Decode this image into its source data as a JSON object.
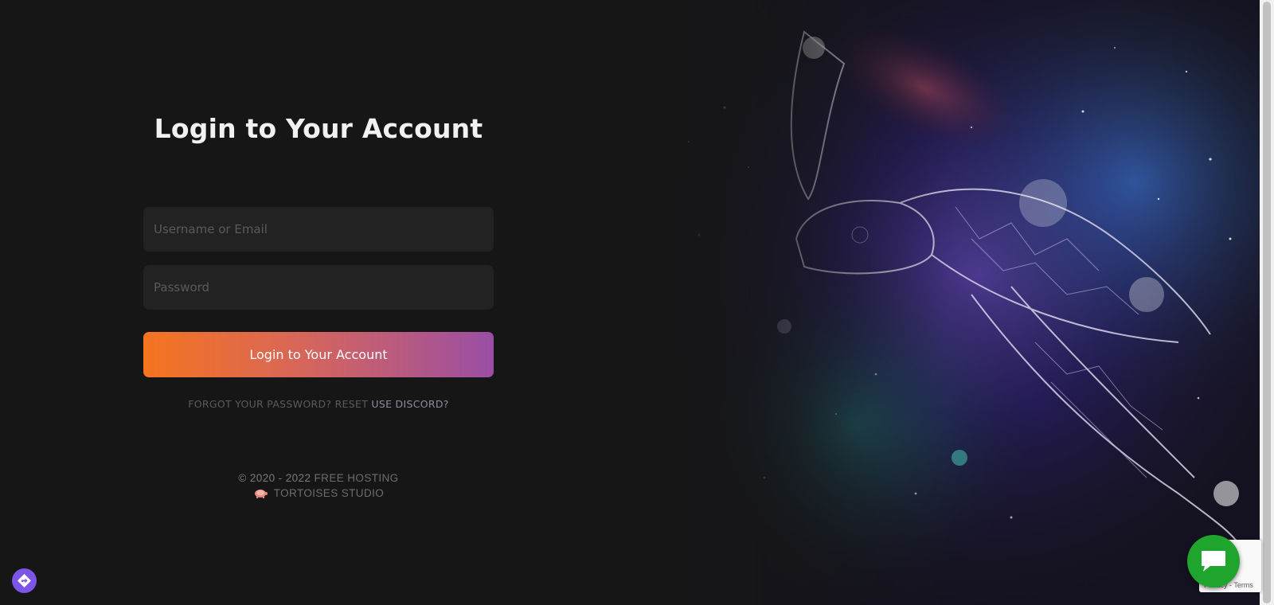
{
  "login": {
    "title": "Login to Your Account",
    "username_placeholder": "Username or Email",
    "password_placeholder": "Password",
    "submit_label": "Login to Your Account",
    "forgot_text": "FORGOT YOUR PASSWORD? RESET",
    "discord_link": "USE DISCORD?"
  },
  "footer": {
    "copyright": "© 2020 - 2022",
    "brand_line1": "FREE HOSTING",
    "brand_line2": "TORTOISES STUDIO"
  },
  "widgets": {
    "recaptcha_terms": "Privacy - Terms",
    "chat_icon": "chat-bubble-icon",
    "corner_icon": "directions-diamond-icon"
  },
  "colors": {
    "background": "#161616",
    "button_gradient_start": "#f6741f",
    "button_gradient_end": "#9a4ea5",
    "chat_button": "#1fa52e",
    "corner_button": "#7b55e8"
  }
}
